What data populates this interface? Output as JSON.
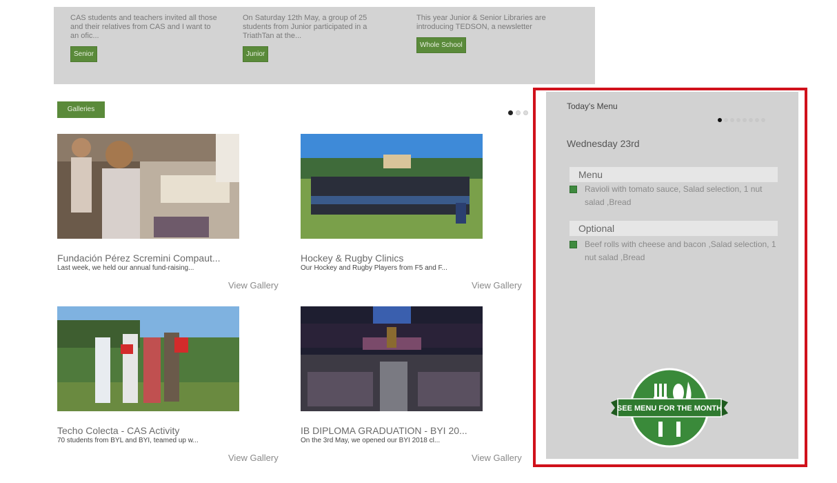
{
  "news": [
    {
      "text": "CAS students and teachers invited all those and their relatives from CAS and I want to an ofic...",
      "tag": "Senior"
    },
    {
      "text": "On Saturday 12th May, a group of 25 students from Junior participated in a TriathTan at the...",
      "tag": "Junior"
    },
    {
      "text": "This year Junior & Senior Libraries are introducing TEDSON, a newsletter",
      "tag": "Whole School"
    }
  ],
  "galleries": {
    "button_label": "Galleries",
    "items": [
      {
        "title": "Fundación Pérez Scremini Compaut...",
        "desc": "Last week, we held our annual fund-raising...",
        "link": "View Gallery"
      },
      {
        "title": "Hockey & Rugby Clinics",
        "desc": "Our Hockey and Rugby Players from F5 and F...",
        "link": "View Gallery"
      },
      {
        "title": "Techo Colecta - CAS Activity",
        "desc": "70 students from BYL and BYI, teamed up w...",
        "link": "View Gallery"
      },
      {
        "title": "IB DIPLOMA GRADUATION - BYI 20...",
        "desc": "On the 3rd May, we opened our BYI 2018 cl...",
        "link": "View Gallery"
      }
    ]
  },
  "menu": {
    "heading": "Today's Menu",
    "day": "Wednesday 23rd",
    "sections": [
      {
        "title": "Menu",
        "item": "Ravioli with tomato sauce, Salad selection, 1 nut salad ,Bread"
      },
      {
        "title": "Optional",
        "item": "Beef rolls with cheese and bacon ,Salad selection, 1 nut salad ,Bread"
      }
    ],
    "badge_text": "SEE MENU FOR THE MONTH"
  },
  "colors": {
    "accent_green": "#5a8a3a",
    "highlight_red": "#d0111b",
    "panel_gray": "#d2d2d2"
  }
}
